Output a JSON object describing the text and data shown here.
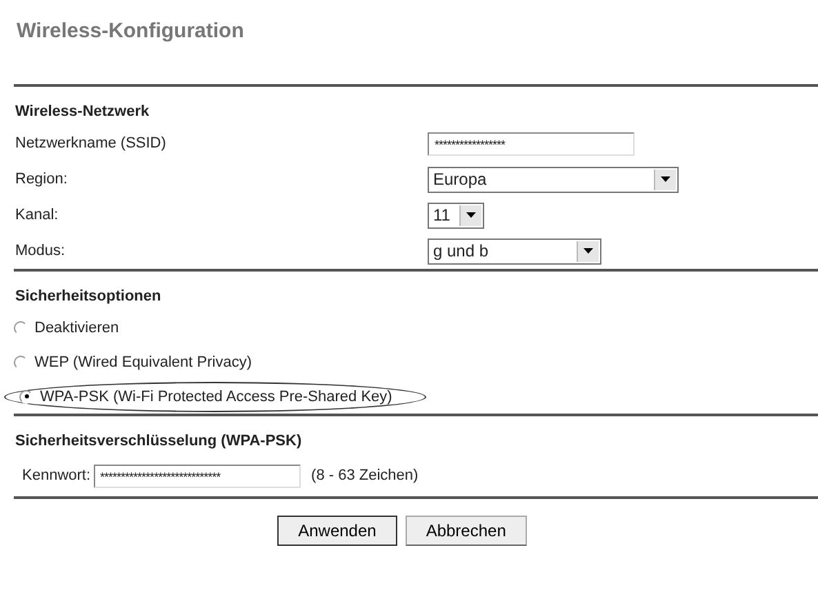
{
  "title": "Wireless-Konfiguration",
  "network": {
    "heading": "Wireless-Netzwerk",
    "fields": [
      {
        "kind": "text",
        "label": "Netzwerkname (SSID)",
        "value": "*****************"
      },
      {
        "kind": "select",
        "label": "Region:",
        "value": "Europa"
      },
      {
        "kind": "select",
        "label": "Kanal:",
        "value": "11"
      },
      {
        "kind": "select",
        "label": "Modus:",
        "value": "g und b"
      }
    ]
  },
  "security": {
    "heading": "Sicherheitsoptionen",
    "options": [
      {
        "label": "Deaktivieren",
        "selected": false
      },
      {
        "label": "WEP (Wired Equivalent Privacy)",
        "selected": false
      },
      {
        "label": "WPA-PSK (Wi-Fi Protected Access Pre-Shared Key)",
        "selected": true
      }
    ]
  },
  "encryption": {
    "heading": "Sicherheitsverschlüsselung (WPA-PSK)",
    "label": "Kennwort:",
    "value": "*****************************",
    "hint": "(8 - 63 Zeichen)"
  },
  "buttons": [
    "Anwenden",
    "Abbrechen"
  ]
}
